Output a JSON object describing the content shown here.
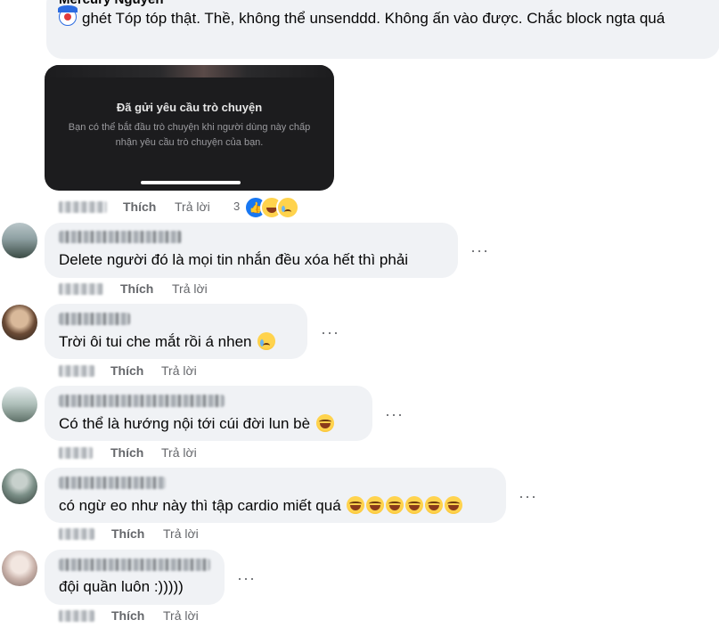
{
  "top_comment": {
    "author": "Mercury Nguyễn",
    "text": "ghét Tóp tóp thật. Thề, không thể unsenddd. Không ấn vào được. Chắc block ngta quá",
    "attachment": {
      "title": "Đã gửi yêu cầu trò chuyện",
      "body": "Bạn có thể bắt đầu trò chuyện khi người dùng này chấp nhận yêu cầu trò chuyện của bạn."
    },
    "actions": {
      "like": "Thích",
      "reply": "Trả lời"
    },
    "reactions": {
      "count": "3"
    }
  },
  "comments": [
    {
      "text": "Delete người đó là mọi tin nhắn đều xóa hết thì phải",
      "emoji": ""
    },
    {
      "text": "Trời ôi tui che mắt rồi á nhen",
      "emoji": "cry"
    },
    {
      "text": "Có thể là hướng nội tới cúi đời lun bè",
      "emoji": "laugh"
    },
    {
      "text": "có ngừ eo như này thì tập cardio miết quá",
      "emoji": "laugh x6"
    },
    {
      "text": "đội quần luôn :)))))",
      "emoji": ""
    }
  ],
  "actions": {
    "like": "Thích",
    "reply": "Trả lời",
    "more": "···"
  },
  "colors": {
    "bubble": "#f0f2f5",
    "muted": "#65676b",
    "text": "#050505",
    "like_blue": "#1877f2"
  }
}
